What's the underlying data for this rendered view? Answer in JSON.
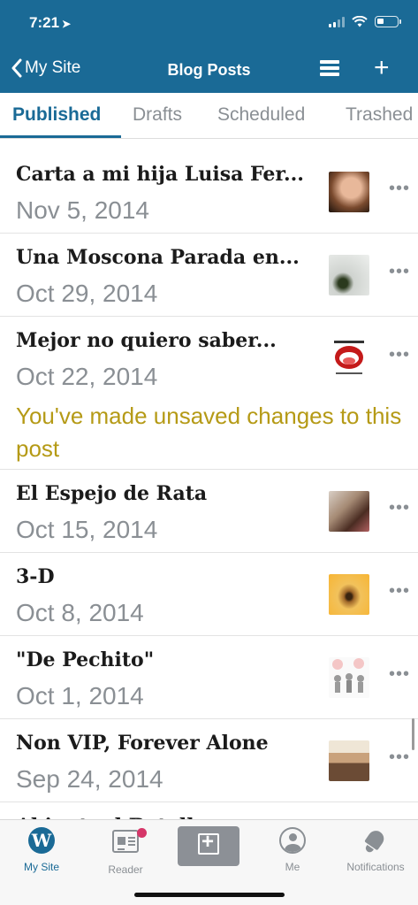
{
  "status_bar": {
    "time": "7:21",
    "location_glyph": "➤"
  },
  "nav": {
    "back_label": "My Site",
    "title": "Blog Posts",
    "add_label": "+"
  },
  "tabs": [
    {
      "label": "Published",
      "active": true
    },
    {
      "label": "Drafts",
      "active": false
    },
    {
      "label": "Scheduled",
      "active": false
    },
    {
      "label": "Trashed",
      "active": false
    }
  ],
  "posts": [
    {
      "title": "Carta a mi hija Luisa Fer...",
      "date": "Nov 5, 2014",
      "thumb": "portrait-photo"
    },
    {
      "title": "Una Moscona Parada en...",
      "date": "Oct 29, 2014",
      "thumb": "fly-photo"
    },
    {
      "title": "Mejor no quiero saber...",
      "date": "Oct 22, 2014",
      "warning": "You've made unsaved changes to this post",
      "thumb": "mouth-cartoon"
    },
    {
      "title": "El Espejo de Rata",
      "date": "Oct 15, 2014",
      "thumb": "mirror-photo"
    },
    {
      "title": "3-D",
      "date": "Oct 8, 2014",
      "thumb": "eye-photo"
    },
    {
      "title": "\"De Pechito\"",
      "date": "Oct 1, 2014",
      "thumb": "figures-illustration"
    },
    {
      "title": "Non VIP, Forever Alone",
      "date": "Sep 24, 2014",
      "thumb": "band-photo"
    },
    {
      "title": "Abi....t.. d Batall",
      "date": "",
      "thumb": ""
    }
  ],
  "more_glyph": "•••",
  "tabbar": [
    {
      "label": "My Site",
      "icon": "wordpress-icon",
      "active": true
    },
    {
      "label": "Reader",
      "icon": "reader-icon",
      "active": false
    },
    {
      "label": "",
      "icon": "compose-icon",
      "active": false
    },
    {
      "label": "Me",
      "icon": "me-icon",
      "active": false
    },
    {
      "label": "Notifications",
      "icon": "bell-icon",
      "active": false
    }
  ],
  "colors": {
    "header": "#1a6a96",
    "accent": "#1a6a96",
    "warning": "#b59a16",
    "muted": "#8a8f94"
  }
}
